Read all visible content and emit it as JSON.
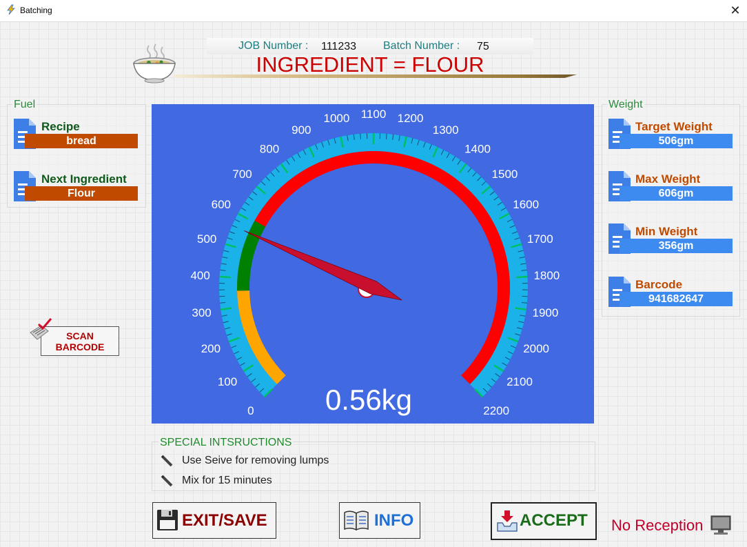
{
  "window": {
    "title": "Batching",
    "close_glyph": "✕"
  },
  "header": {
    "job_label": "JOB Number :",
    "job_value": "111233",
    "batch_label": "Batch Number :",
    "batch_value": "75",
    "ingredient_title": "INGREDIENT = FLOUR"
  },
  "fuel": {
    "title": "Fuel",
    "recipe_label": "Recipe",
    "recipe_value": "bread",
    "next_label": "Next Ingredient",
    "next_value": "Flour"
  },
  "weight": {
    "title": "Weight",
    "target_label": "Target Weight",
    "target_value": "506gm",
    "max_label": "Max Weight",
    "max_value": "606gm",
    "min_label": "Min Weight",
    "min_value": "356gm",
    "barcode_label": "Barcode",
    "barcode_value": "941682647"
  },
  "scan": {
    "label": "SCAN\nBARCODE"
  },
  "gauge": {
    "readout": "0.56kg",
    "min": 0,
    "max": 2200,
    "major_step": 100,
    "needle_value": 560,
    "bands": [
      {
        "from": 0,
        "to": 356,
        "color": "#ffa500"
      },
      {
        "from": 356,
        "to": 606,
        "color": "#008000"
      },
      {
        "from": 606,
        "to": 2200,
        "color": "#ff0000"
      }
    ],
    "tick_labels": [
      "0",
      "100",
      "200",
      "300",
      "400",
      "500",
      "600",
      "700",
      "800",
      "900",
      "1000",
      "1100",
      "1200",
      "1300",
      "1400",
      "1500",
      "1600",
      "1700",
      "1800",
      "1900",
      "2000",
      "2100",
      "2200"
    ],
    "colors": {
      "background": "#4169e1",
      "scale": "#1ab2e8",
      "tick": "#00c060",
      "needle": "#c8102e"
    }
  },
  "instructions": {
    "title": "SPECIAL INTSRUCTIONS",
    "items": [
      "Use Seive for removing lumps",
      "Mix for 15 minutes"
    ]
  },
  "buttons": {
    "exit_save": "EXIT/SAVE",
    "info": "INFO",
    "accept": "ACCEPT"
  },
  "status": {
    "reception": "No Reception"
  },
  "colors": {
    "accent_red": "#c00000",
    "accent_green": "#1e8a2a",
    "value_orange": "#c04a00",
    "value_blue": "#3d8bf0"
  }
}
